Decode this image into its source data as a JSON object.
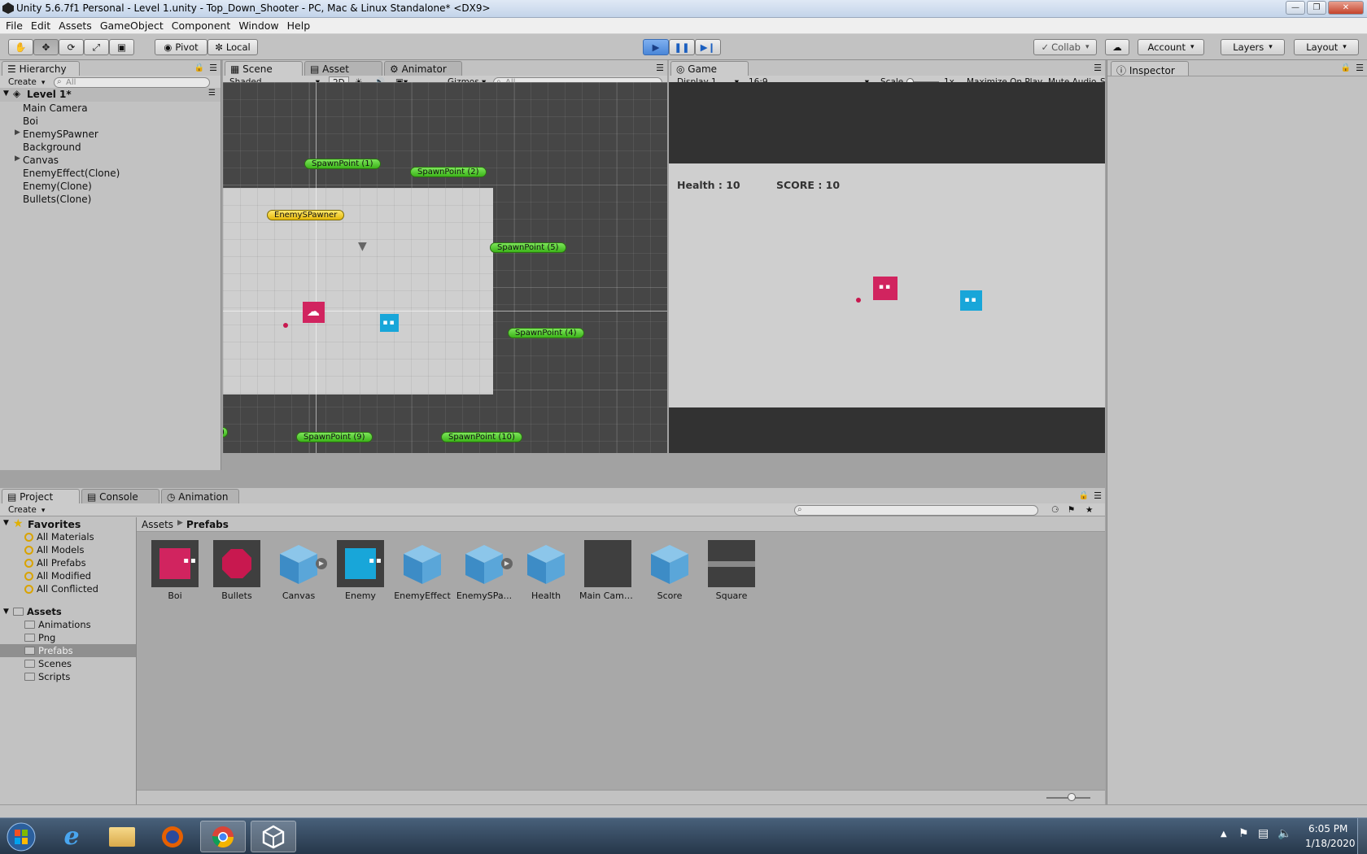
{
  "window": {
    "title": "Unity 5.6.7f1 Personal - Level 1.unity - Top_Down_Shooter - PC, Mac & Linux Standalone* <DX9>"
  },
  "menu": [
    "File",
    "Edit",
    "Assets",
    "GameObject",
    "Component",
    "Window",
    "Help"
  ],
  "toolbar": {
    "pivot": "Pivot",
    "local": "Local",
    "collab": "Collab",
    "account": "Account",
    "layers": "Layers",
    "layout": "Layout"
  },
  "hierarchy": {
    "tab": "Hierarchy",
    "create": "Create",
    "search_placeholder": "All",
    "scene": "Level 1*",
    "items": [
      "Main Camera",
      "Boi",
      "EnemySPawner",
      "Background",
      "Canvas",
      "EnemyEffect(Clone)",
      "Enemy(Clone)",
      "Bullets(Clone)"
    ]
  },
  "scene": {
    "tabs": [
      "Scene",
      "Asset Store",
      "Animator"
    ],
    "shading": "Shaded",
    "mode2d": "2D",
    "gizmos": "Gizmos",
    "search_placeholder": "All",
    "labels": {
      "sp1": "SpawnPoint (1)",
      "sp2": "SpawnPoint (2)",
      "spawner": "EnemySPawner",
      "sp5": "SpawnPoint (5)",
      "sp4": "SpawnPoint (4)",
      "sp9": "SpawnPoint (9)",
      "sp10": "SpawnPoint (10)",
      "partial": ")"
    }
  },
  "game": {
    "tab": "Game",
    "display": "Display 1",
    "aspect": "16:9",
    "scale_label": "Scale",
    "scale_value": "1x",
    "maximize": "Maximize On Play",
    "mute": "Mute Audio",
    "stats_partial": "S",
    "health": "Health : 10",
    "score": "SCORE : 10"
  },
  "inspector": {
    "tab": "Inspector"
  },
  "project": {
    "tabs": [
      "Project",
      "Console",
      "Animation"
    ],
    "create": "Create",
    "favorites_label": "Favorites",
    "favorites": [
      "All Materials",
      "All Models",
      "All Prefabs",
      "All Modified",
      "All Conflicted"
    ],
    "assets_label": "Assets",
    "folders": [
      "Animations",
      "Png",
      "Prefabs",
      "Scenes",
      "Scripts"
    ],
    "breadcrumb": [
      "Assets",
      "Prefabs"
    ],
    "assets": [
      "Boi",
      "Bullets",
      "Canvas",
      "Enemy",
      "EnemyEffect",
      "EnemySPa...",
      "Health",
      "Main Came...",
      "Score",
      "Square"
    ]
  },
  "taskbar": {
    "time": "6:05 PM",
    "date": "1/18/2020"
  },
  "colors": {
    "boi": "#d1245f",
    "enemy": "#18a6d9",
    "play_active": "#4a86d8",
    "spawn_pill": "#3cb419",
    "spawner_pill": "#e4b80b"
  },
  "icons": [
    "hand-tool-icon",
    "move-tool-icon",
    "rotate-tool-icon",
    "scale-tool-icon",
    "rect-tool-icon",
    "play-icon",
    "pause-icon",
    "step-icon",
    "cloud-icon",
    "lock-icon",
    "star-icon",
    "folder-icon",
    "cube-prefab-icon",
    "windows-start-icon",
    "ie-icon",
    "explorer-icon",
    "firefox-icon",
    "chrome-icon",
    "unity-icon"
  ]
}
